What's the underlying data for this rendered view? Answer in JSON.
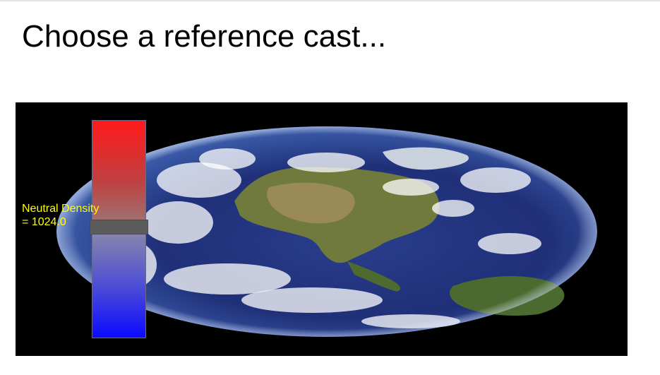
{
  "page": {
    "title": "Choose a reference cast..."
  },
  "map": {
    "image": "earth-globe-north-america",
    "density_label_line1": "Neutral Density",
    "density_label_line2": "= 1024.0",
    "label_color": "#ffff00",
    "slider": {
      "top_color": "#ff1a1a",
      "bottom_color": "#0a0aff",
      "handle_level": 0.49
    }
  }
}
